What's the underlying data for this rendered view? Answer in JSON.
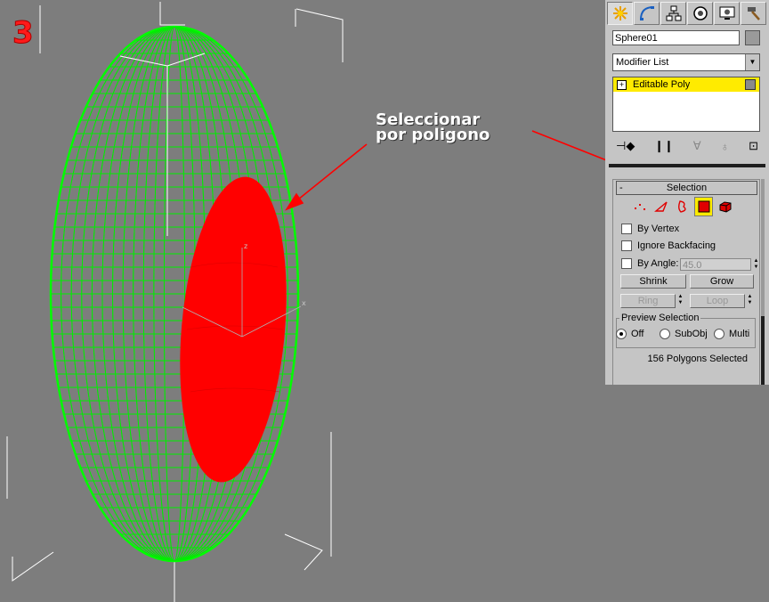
{
  "step": {
    "number": "3"
  },
  "annotation": {
    "line1": "Seleccionar",
    "line2": "por poligono"
  },
  "colors": {
    "wireframe": "#00ff00",
    "selection": "#ff0000",
    "viewport_bg": "#7d7d7d",
    "highlight": "#ffeb00"
  },
  "command_panel": {
    "tabs": [
      {
        "icon": "create-icon",
        "active": true
      },
      {
        "icon": "modify-icon",
        "active": false
      },
      {
        "icon": "hierarchy-icon",
        "active": false
      },
      {
        "icon": "motion-icon",
        "active": false
      },
      {
        "icon": "display-icon",
        "active": false
      },
      {
        "icon": "utilities-icon",
        "active": false
      }
    ],
    "object_name": "Sphere01",
    "modifier_list_label": "Modifier List",
    "stack_item": "Editable Poly"
  },
  "selection_rollout": {
    "title": "Selection",
    "collapse_symbol": "-",
    "modes": [
      "vertex-icon",
      "edge-icon",
      "border-icon",
      "polygon-icon",
      "element-icon"
    ],
    "active_mode": "polygon-icon",
    "by_vertex": "By Vertex",
    "ignore_backfacing": "Ignore Backfacing",
    "by_angle": "By Angle:",
    "angle_value": "45.0",
    "shrink": "Shrink",
    "grow": "Grow",
    "ring": "Ring",
    "loop": "Loop",
    "preview_title": "Preview Selection",
    "preview_off": "Off",
    "preview_subobj": "SubObj",
    "preview_multi": "Multi",
    "status": "156 Polygons Selected"
  }
}
